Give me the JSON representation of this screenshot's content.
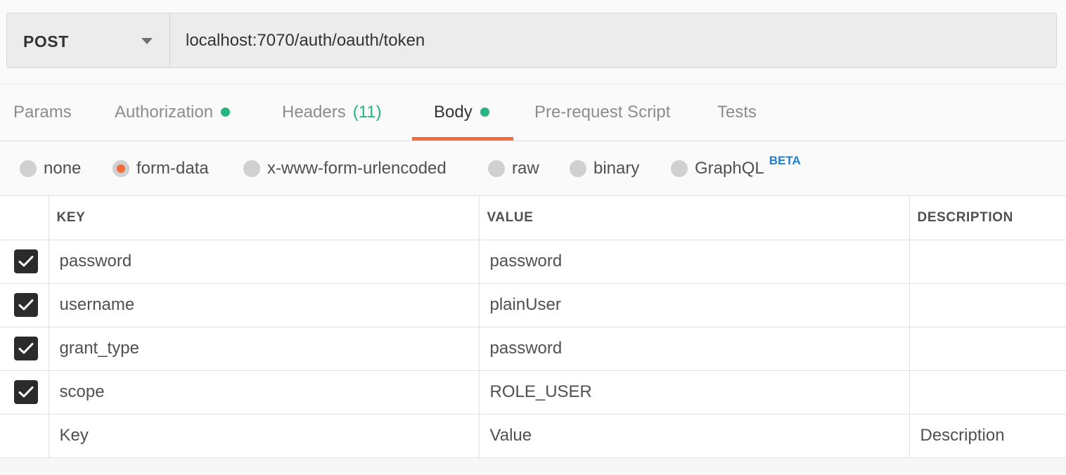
{
  "request": {
    "method": "POST",
    "url": "localhost:7070/auth/oauth/token"
  },
  "tabs": [
    {
      "label": "Params"
    },
    {
      "label": "Authorization",
      "dot": true
    },
    {
      "label": "Headers",
      "count": "(11)"
    },
    {
      "label": "Body",
      "dot": true,
      "active": true
    },
    {
      "label": "Pre-request Script"
    },
    {
      "label": "Tests"
    }
  ],
  "body_types": [
    {
      "label": "none",
      "selected": false
    },
    {
      "label": "form-data",
      "selected": true
    },
    {
      "label": "x-www-form-urlencoded",
      "selected": false
    },
    {
      "label": "raw",
      "selected": false
    },
    {
      "label": "binary",
      "selected": false
    },
    {
      "label": "GraphQL",
      "selected": false,
      "badge": "BETA"
    }
  ],
  "table": {
    "headers": {
      "key": "KEY",
      "value": "VALUE",
      "description": "DESCRIPTION"
    },
    "rows": [
      {
        "checked": true,
        "key": "password",
        "value": "password",
        "description": ""
      },
      {
        "checked": true,
        "key": "username",
        "value": "plainUser",
        "description": ""
      },
      {
        "checked": true,
        "key": "grant_type",
        "value": "password",
        "description": ""
      },
      {
        "checked": true,
        "key": "scope",
        "value": "ROLE_USER",
        "description": ""
      }
    ],
    "placeholders": {
      "key": "Key",
      "value": "Value",
      "description": "Description"
    }
  },
  "colors": {
    "accent": "#f26b3a",
    "status_dot": "#26b47f",
    "beta": "#1a7fd6"
  }
}
